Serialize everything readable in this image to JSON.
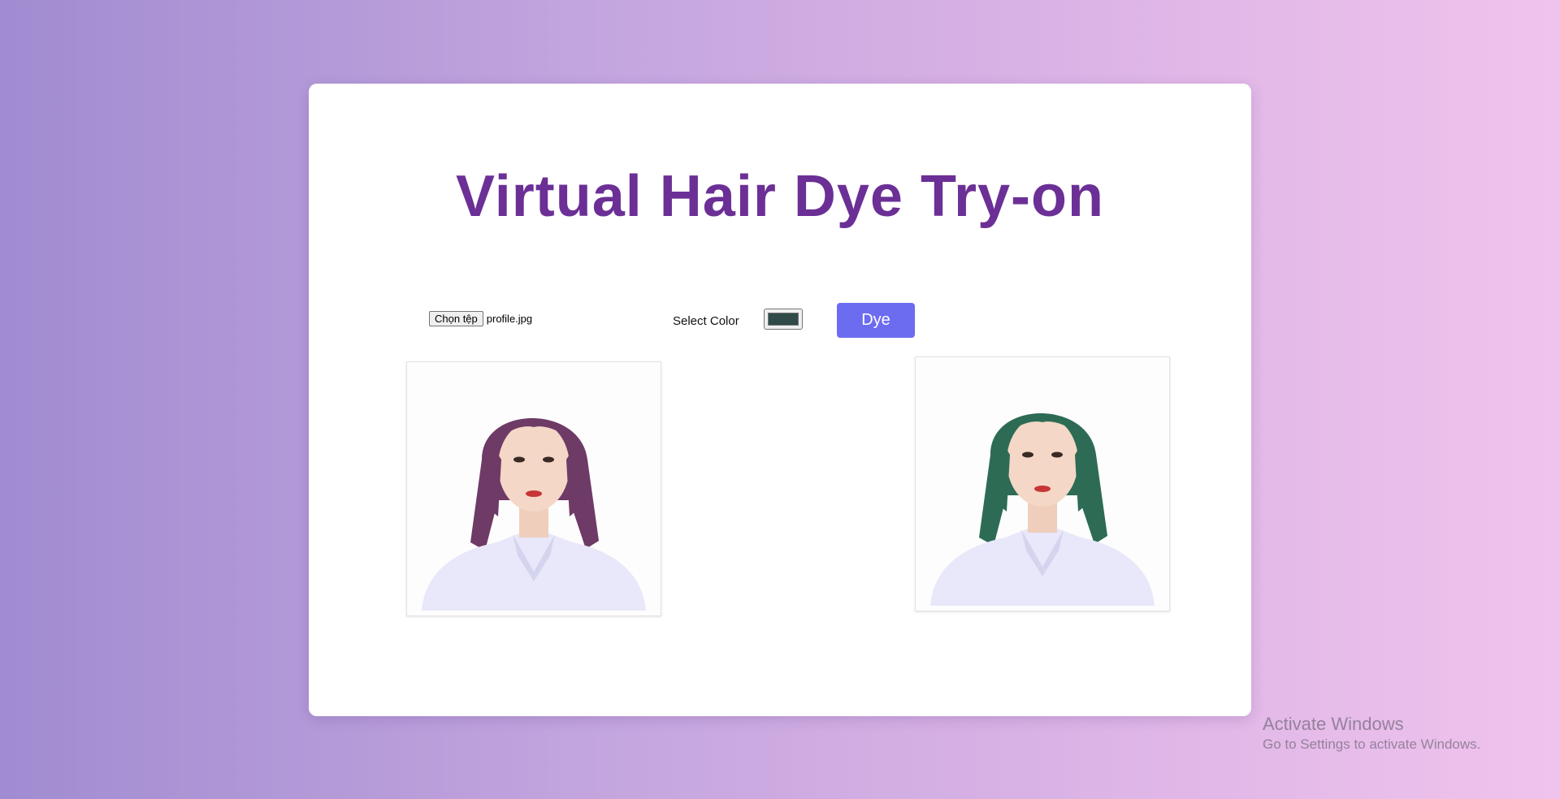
{
  "page": {
    "title": "Virtual Hair Dye Try-on"
  },
  "controls": {
    "file_button_label": "Chọn tệp",
    "file_name": "profile.jpg",
    "color_label": "Select Color",
    "selected_color": "#2f4a48",
    "dye_button_label": "Dye"
  },
  "images": {
    "original": {
      "hair_color": "#6e3a66"
    },
    "result": {
      "hair_color": "#2d6b55"
    }
  },
  "watermark": {
    "title": "Activate Windows",
    "subtitle": "Go to Settings to activate Windows."
  },
  "colors": {
    "accent": "#6b2f96",
    "button": "#6c6cf0"
  }
}
